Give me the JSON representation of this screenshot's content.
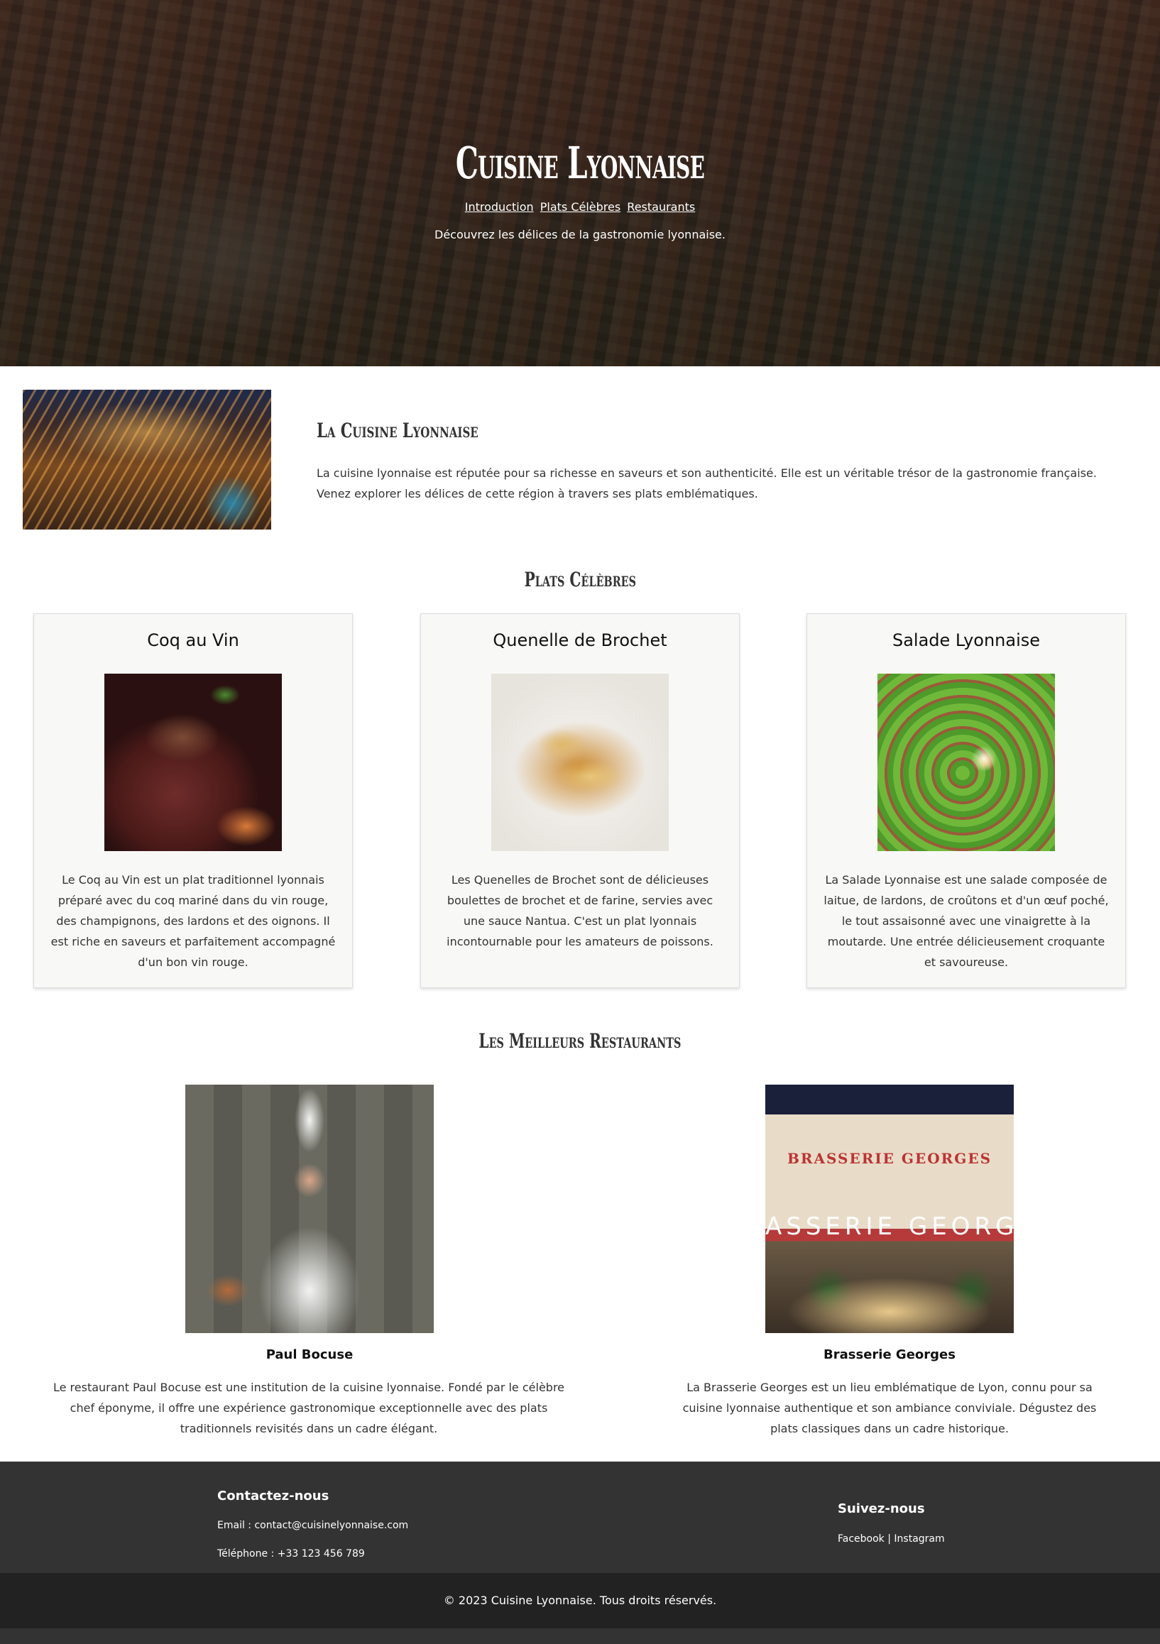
{
  "hero": {
    "title": "Cuisine Lyonnaise",
    "nav": [
      "Introduction",
      "Plats Célèbres",
      "Restaurants"
    ],
    "tagline": "Découvrez les délices de la gastronomie lyonnaise."
  },
  "intro": {
    "title": "La Cuisine Lyonnaise",
    "text": "La cuisine lyonnaise est réputée pour sa richesse en saveurs et son authenticité. Elle est un véritable trésor de la gastronomie française. Venez explorer les délices de cette région à travers ses plats emblématiques."
  },
  "dishes": {
    "title": "Plats Célèbres",
    "items": [
      {
        "name": "Coq au Vin",
        "text": "Le Coq au Vin est un plat traditionnel lyonnais préparé avec du coq mariné dans du vin rouge, des champignons, des lardons et des oignons. Il est riche en saveurs et parfaitement accompagné d'un bon vin rouge."
      },
      {
        "name": "Quenelle de Brochet",
        "text": "Les Quenelles de Brochet sont de délicieuses boulettes de brochet et de farine, servies avec une sauce Nantua. C'est un plat lyonnais incontournable pour les amateurs de poissons."
      },
      {
        "name": "Salade Lyonnaise",
        "text": "La Salade Lyonnaise est une salade composée de laitue, de lardons, de croûtons et d'un œuf poché, le tout assaisonné avec une vinaigrette à la moutarde. Une entrée délicieusement croquante et savoureuse."
      }
    ]
  },
  "restaurants": {
    "title": "Les Meilleurs Restaurants",
    "items": [
      {
        "name": "Paul Bocuse",
        "text": "Le restaurant Paul Bocuse est une institution de la cuisine lyonnaise. Fondé par le célèbre chef éponyme, il offre une expérience gastronomique exceptionnelle avec des plats traditionnels revisités dans un cadre élégant."
      },
      {
        "name": "Brasserie Georges",
        "text": "La Brasserie Georges est un lieu emblématique de Lyon, connu pour sa cuisine lyonnaise authentique et son ambiance conviviale. Dégustez des plats classiques dans un cadre historique.",
        "sign_top": "BRASSERIE GEORGES",
        "sign_bottom": "ASSERIE GEORGE"
      }
    ]
  },
  "footer": {
    "contact_title": "Contactez-nous",
    "email": "Email : contact@cuisinelyonnaise.com",
    "phone": "Téléphone : +33 123 456 789",
    "social_title": "Suivez-nous",
    "facebook": "Facebook",
    "separator": "|",
    "instagram": "Instagram",
    "copyright": "© 2023 Cuisine Lyonnaise. Tous droits réservés."
  }
}
